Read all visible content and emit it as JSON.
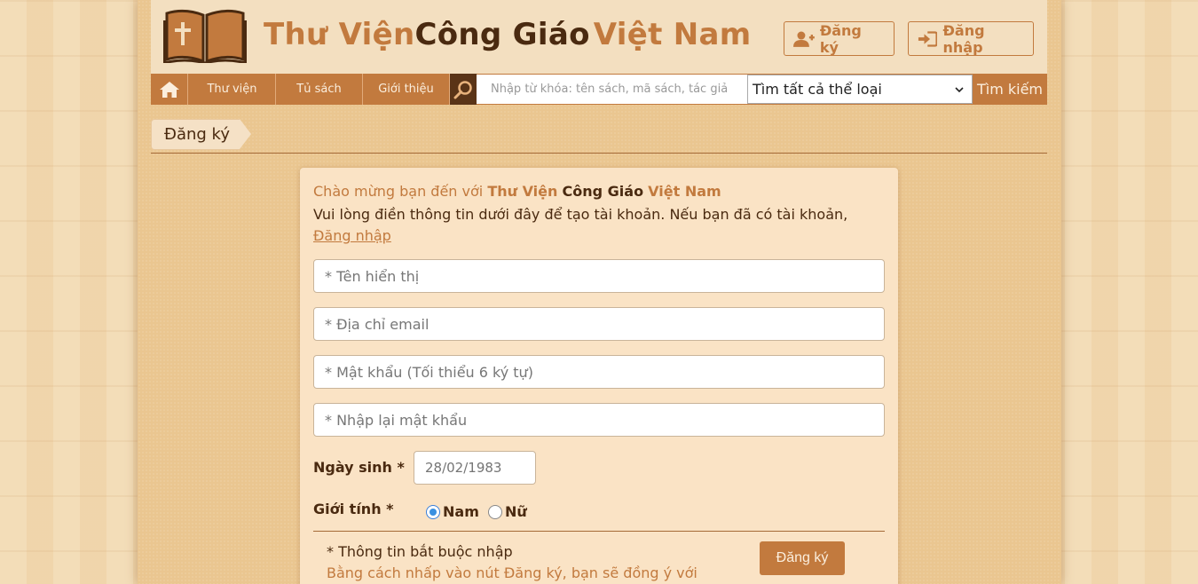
{
  "header": {
    "brand_part1": "Thư Viện",
    "brand_part2": "Công Giáo",
    "brand_part3": "Việt Nam",
    "register_label": "Đăng ký",
    "login_label": "Đăng nhập"
  },
  "nav": {
    "items": [
      {
        "label": "Thư viện"
      },
      {
        "label": "Tủ sách"
      },
      {
        "label": "Giới thiệu"
      }
    ],
    "search_placeholder": "Nhập từ khóa: tên sách, mã sách, tác giả",
    "category_selected": "Tìm tất cả thể loại",
    "search_button": "Tìm kiếm"
  },
  "breadcrumb": {
    "current": "Đăng ký"
  },
  "form": {
    "welcome_prefix": "Chào mừng bạn đến với ",
    "intro_text": "Vui lòng điền thông tin dưới đây để tạo tài khoản. Nếu bạn đã có tài khoản, ",
    "intro_link": "Đăng nhập",
    "fields": {
      "display_name_placeholder": "* Tên hiển thị",
      "email_placeholder": "* Địa chỉ email",
      "password_placeholder": "* Mật khẩu (Tối thiểu 6 ký tự)",
      "confirm_password_placeholder": "* Nhập lại mật khẩu"
    },
    "birthday_label": "Ngày sinh *",
    "birthday_placeholder": "28/02/1983",
    "gender_label": "Giới tính *",
    "gender_options": [
      {
        "label": "Nam",
        "selected": true
      },
      {
        "label": "Nữ",
        "selected": false
      }
    ],
    "required_note": "* Thông tin bắt buộc nhập",
    "agree_text": "Bằng cách nhấp vào nút Đăng ký, bạn sẽ đồng ý với",
    "submit_label": "Đăng ký"
  },
  "colors": {
    "accent": "#c27a3e",
    "dark": "#4a2a10",
    "card_bg": "#fae3c5"
  },
  "icons": {
    "logo": "open-book-cross-icon",
    "register": "user-plus-icon",
    "login": "sign-in-icon",
    "home": "home-icon",
    "search": "magnifier-icon",
    "select": "chevron-down-icon"
  }
}
